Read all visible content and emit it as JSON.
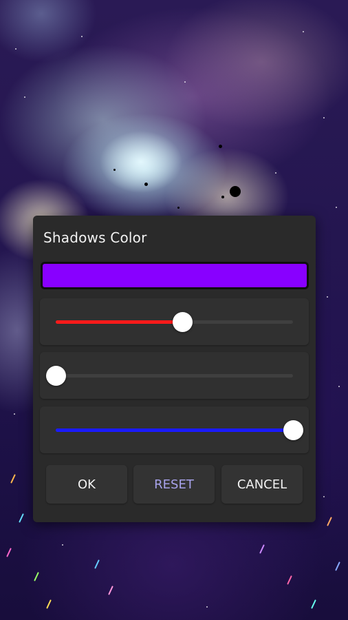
{
  "dialog": {
    "title": "Shadows Color",
    "preview_color": "#8800ff",
    "sliders": [
      {
        "channel": "red",
        "value": 136,
        "max": 255,
        "color": "#ff1a1a"
      },
      {
        "channel": "green",
        "value": 0,
        "max": 255,
        "color": "#1aff1a"
      },
      {
        "channel": "blue",
        "value": 255,
        "max": 255,
        "color": "#1a1aff"
      }
    ],
    "buttons": {
      "ok": "OK",
      "reset": "RESET",
      "cancel": "CANCEL"
    },
    "reset_text_color": "#a7a2ea"
  }
}
